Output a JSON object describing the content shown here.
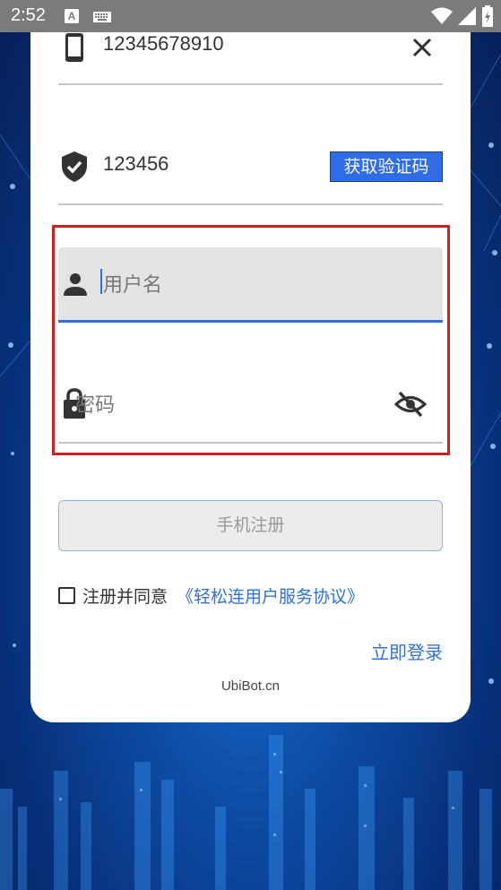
{
  "status_bar": {
    "time": "2:52",
    "notification_icon": "A",
    "icons": [
      "keyboard-icon",
      "wifi-icon",
      "signal-icon",
      "battery-icon"
    ]
  },
  "form": {
    "phone": {
      "value": "12345678910",
      "icon": "phone-icon",
      "clear_icon": "close-icon"
    },
    "code": {
      "value": "123456",
      "icon": "shield-check-icon",
      "button_label": "获取验证码"
    },
    "username": {
      "placeholder": "用户名",
      "icon": "person-icon"
    },
    "password": {
      "placeholder": "密码",
      "icon": "lock-icon",
      "toggle_icon": "eye-off-icon"
    },
    "register_button": "手机注册",
    "agreement": {
      "text": "注册并同意",
      "link": "《轻松连用户服务协议》",
      "checked": false
    },
    "login_link": "立即登录",
    "site": "UbiBot.cn"
  },
  "colors": {
    "accent": "#2f6de6",
    "link": "#2f73d8",
    "highlight": "#cc1f1f",
    "status_bar": "#7b7b7b"
  }
}
